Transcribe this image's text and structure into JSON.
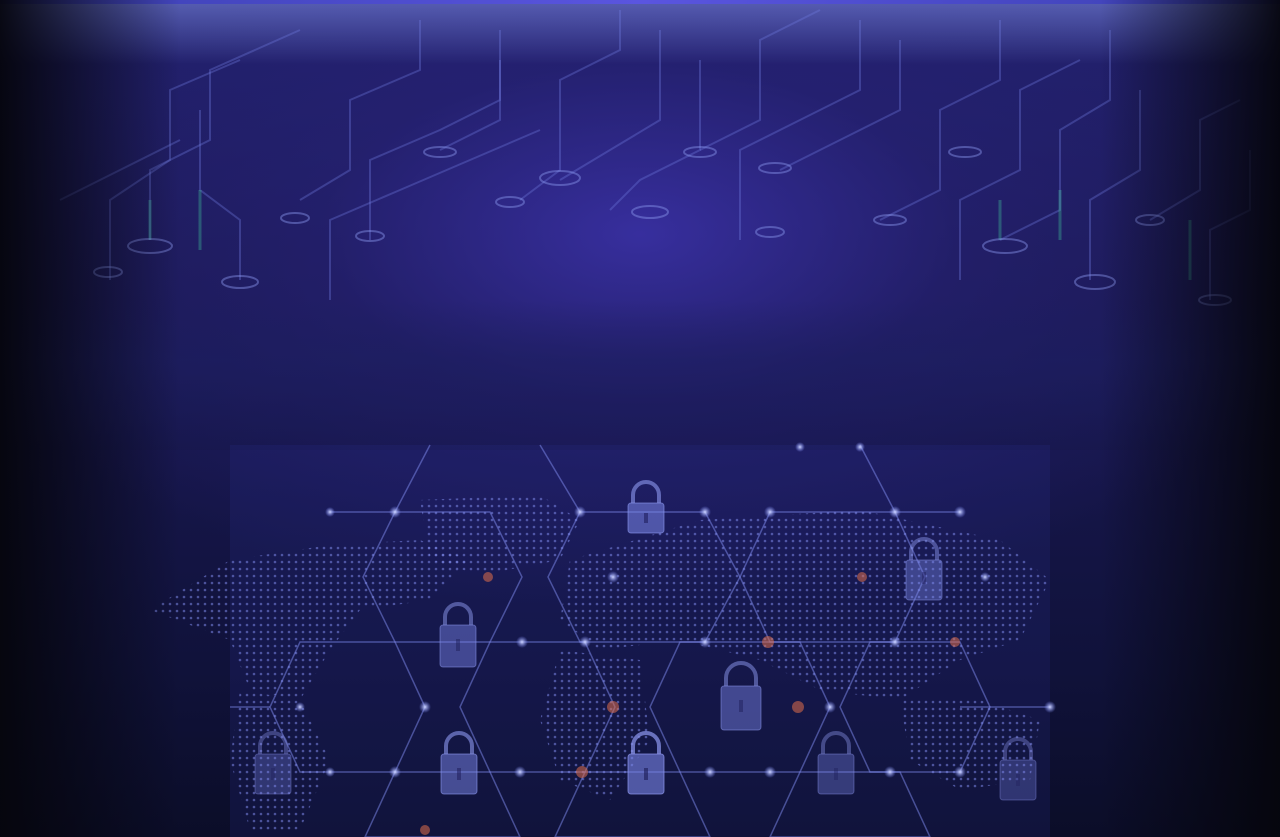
{
  "scene": {
    "theme": "cybersecurity-hero-background",
    "colors": {
      "base": "#16164a",
      "accent": "#5a55e0",
      "circuit": "#6f7be0",
      "circuit_green": "#3fc79a",
      "node_orange": "#e0704a",
      "lock": "#7a86e8"
    },
    "icons": [
      "circuit-board",
      "world-map-dots",
      "hexagon-network",
      "padlock-icon"
    ]
  }
}
